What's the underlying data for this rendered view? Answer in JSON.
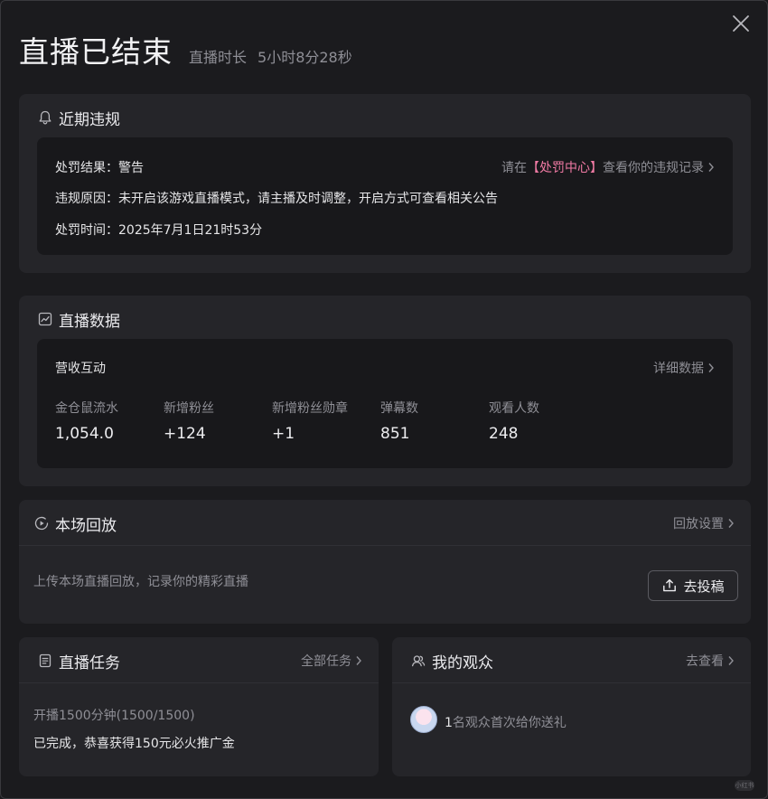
{
  "header": {
    "title": "直播已结束",
    "duration_label": "直播时长",
    "duration_value": "5小时8分28秒"
  },
  "violation": {
    "section_title": "近期违规",
    "result_label": "处罚结果：警告",
    "link_prefix": "请在",
    "link_center": "【处罚中心】",
    "link_suffix": "查看你的违规记录",
    "reason": "违规原因：未开启该游戏直播模式，请主播及时调整，开启方式可查看相关公告",
    "time": "处罚时间：2025年7月1日21时53分"
  },
  "live_data": {
    "section_title": "直播数据",
    "sub_title": "营收互动",
    "detail_link": "详细数据",
    "stats": [
      {
        "label": "金仓鼠流水",
        "value": "1,054.0"
      },
      {
        "label": "新增粉丝",
        "value": "+124"
      },
      {
        "label": "新增粉丝勋章",
        "value": "+1"
      },
      {
        "label": "弹幕数",
        "value": "851"
      },
      {
        "label": "观看人数",
        "value": "248"
      }
    ]
  },
  "replay": {
    "section_title": "本场回放",
    "settings_link": "回放设置",
    "description": "上传本场直播回放，记录你的精彩直播",
    "upload_button": "去投稿"
  },
  "tasks": {
    "section_title": "直播任务",
    "all_link": "全部任务",
    "task_name": "开播1500分钟(1500/1500)",
    "task_result": "已完成，恭喜获得150元必火推广金"
  },
  "audience": {
    "section_title": "我的观众",
    "view_link": "去查看",
    "gift_count": "1",
    "gift_text": "名观众首次给你送礼"
  },
  "colors": {
    "background": "#1b1b1e",
    "card": "#252529",
    "inner": "#18181b",
    "accent_pink": "#f07aa4",
    "muted_text": "#8f8f96"
  },
  "icons": {
    "close": "close-icon",
    "bell": "bell-icon",
    "chart": "chart-icon",
    "play": "play-circle-icon",
    "document": "document-icon",
    "audience": "users-icon",
    "upload": "upload-icon"
  },
  "watermark": "小红书"
}
